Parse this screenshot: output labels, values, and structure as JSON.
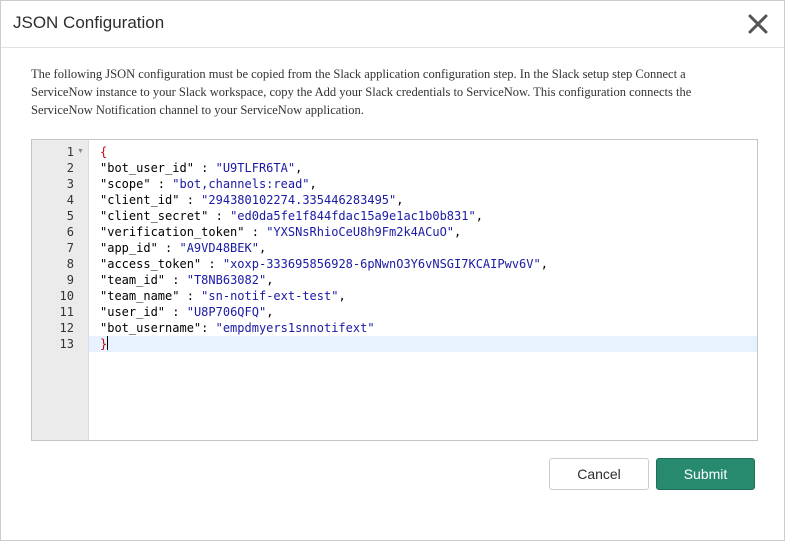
{
  "dialog": {
    "title": "JSON Configuration",
    "close_icon": "close-x-icon",
    "description": "The following JSON configuration must be copied from the Slack application configuration step.  In the Slack setup step Connect a ServiceNow instance to your Slack workspace, copy the Add your Slack credentials to ServiceNow.  This configuration connects the ServiceNow Notification channel to your ServiceNow application."
  },
  "editor": {
    "open_brace": "{",
    "close_brace": "}",
    "fold_icon": "fold-triangle-icon",
    "line_numbers": [
      "1",
      "2",
      "3",
      "4",
      "5",
      "6",
      "7",
      "8",
      "9",
      "10",
      "11",
      "12",
      "13"
    ],
    "entries": [
      {
        "key": "\"bot_user_id\"",
        "sep": " : ",
        "value": "\"U9TLFR6TA\"",
        "trail": ","
      },
      {
        "key": "\"scope\"",
        "sep": " : ",
        "value": "\"bot,channels:read\"",
        "trail": ","
      },
      {
        "key": "\"client_id\"",
        "sep": " : ",
        "value": "\"294380102274.335446283495\"",
        "trail": ","
      },
      {
        "key": "\"client_secret\"",
        "sep": " : ",
        "value": "\"ed0da5fe1f844fdac15a9e1ac1b0b831\"",
        "trail": ","
      },
      {
        "key": "\"verification_token\"",
        "sep": " : ",
        "value": "\"YXSNsRhioCeU8h9Fm2k4ACuO\"",
        "trail": ","
      },
      {
        "key": "\"app_id\"",
        "sep": " : ",
        "value": "\"A9VD48BEK\"",
        "trail": ","
      },
      {
        "key": "\"access_token\"",
        "sep": " : ",
        "value": "\"xoxp-333695856928-6pNwnO3Y6vNSGI7KCAIPwv6V\"",
        "trail": ","
      },
      {
        "key": "\"team_id\"",
        "sep": " : ",
        "value": "\"T8NB63082\"",
        "trail": ","
      },
      {
        "key": "\"team_name\"",
        "sep": " : ",
        "value": "\"sn-notif-ext-test\"",
        "trail": ","
      },
      {
        "key": "\"user_id\"",
        "sep": " : ",
        "value": "\"U8P706QFQ\"",
        "trail": ","
      },
      {
        "key": "\"bot_username\"",
        "sep": ": ",
        "value": "\"empdmyers1snnotifext\"",
        "trail": ""
      }
    ]
  },
  "buttons": {
    "cancel_label": "Cancel",
    "submit_label": "Submit"
  },
  "colors": {
    "submit_bg": "#278a6f",
    "string_value": "#1a1aa6",
    "brace": "#c5060b",
    "active_line": "#e8f2fe"
  }
}
